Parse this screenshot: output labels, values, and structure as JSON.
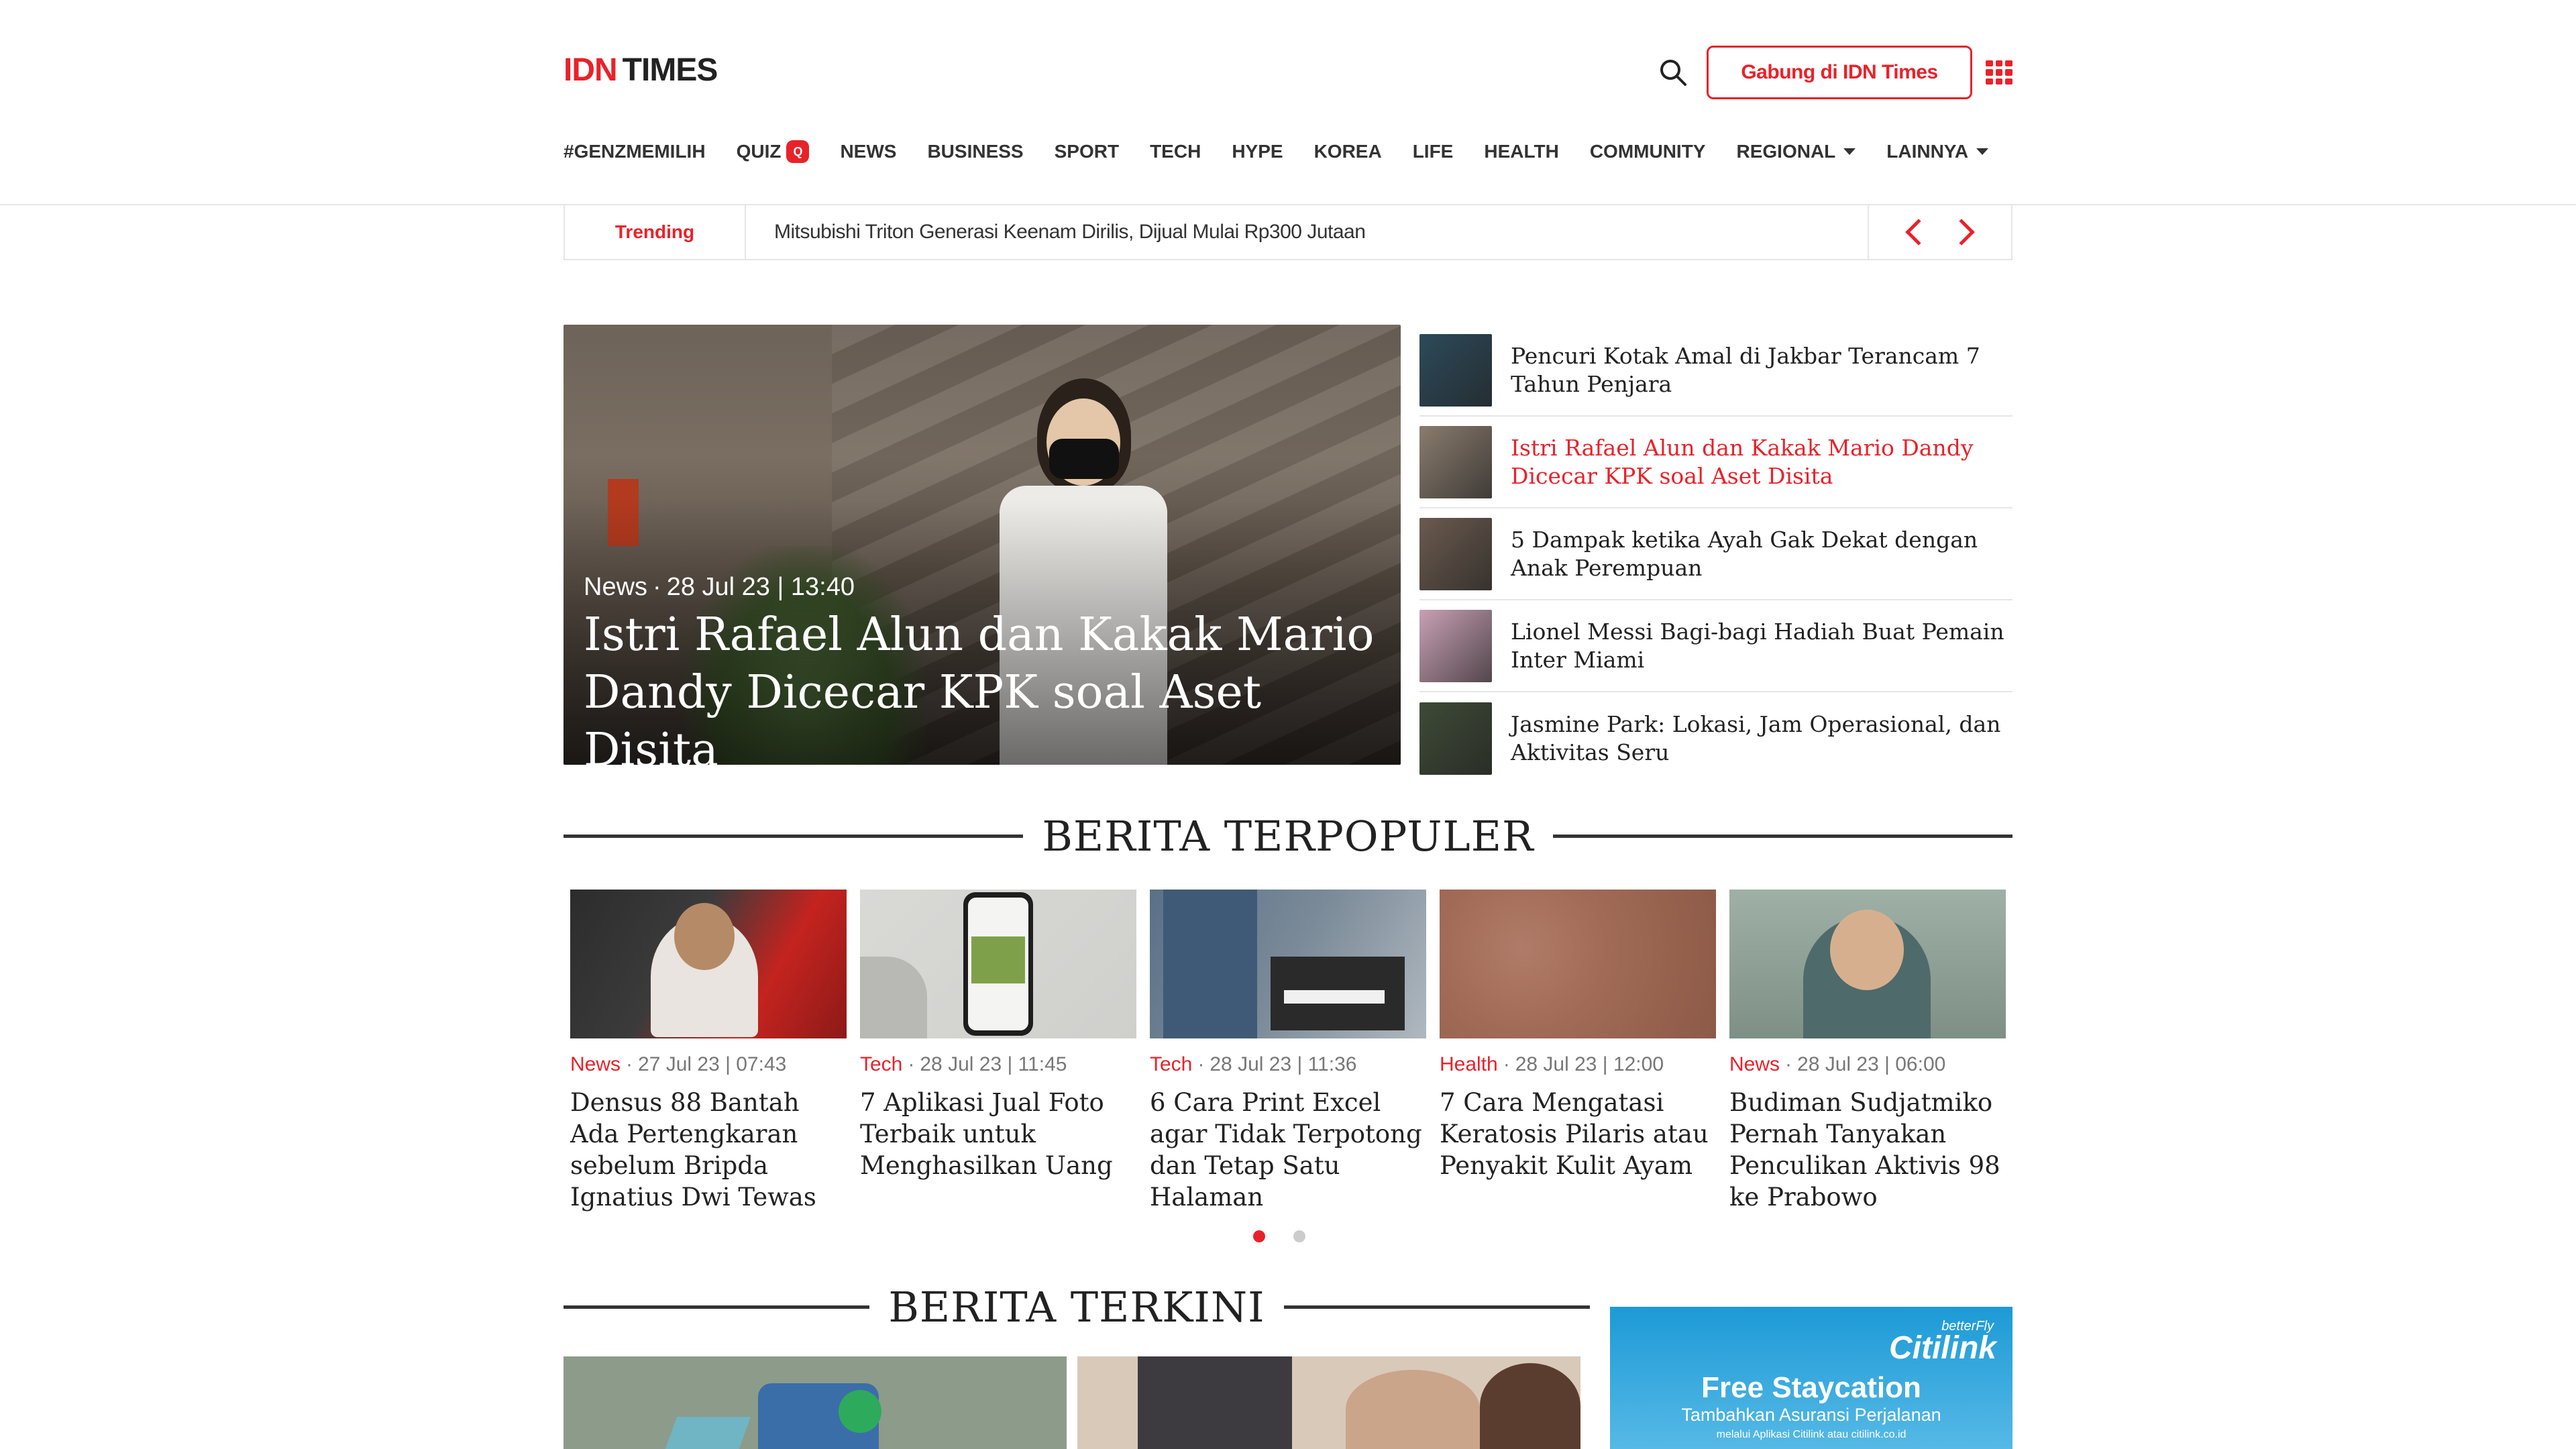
{
  "header": {
    "logo_idn": "IDN",
    "logo_times": "TIMES",
    "join_label": "Gabung di IDN Times"
  },
  "nav": {
    "items": [
      {
        "label": "#GENZMEMILIH"
      },
      {
        "label": "QUIZ",
        "badge": "Q"
      },
      {
        "label": "NEWS"
      },
      {
        "label": "BUSINESS"
      },
      {
        "label": "SPORT"
      },
      {
        "label": "TECH"
      },
      {
        "label": "HYPE"
      },
      {
        "label": "KOREA"
      },
      {
        "label": "LIFE"
      },
      {
        "label": "HEALTH"
      },
      {
        "label": "COMMUNITY"
      },
      {
        "label": "REGIONAL"
      },
      {
        "label": "LAINNYA"
      }
    ]
  },
  "trending": {
    "label": "Trending",
    "headline": "Mitsubishi Triton Generasi Keenam Dirilis, Dijual Mulai Rp300 Jutaan"
  },
  "hero": {
    "category": "News",
    "date": "28 Jul 23 | 13:40",
    "title": "Istri Rafael Alun dan Kakak Mario Dandy Dicecar KPK soal Aset Disita"
  },
  "side_list": [
    {
      "title": "Pencuri Kotak Amal di Jakbar Terancam 7 Tahun Penjara",
      "active": false,
      "color": "#2d4a5a"
    },
    {
      "title": "Istri Rafael Alun dan Kakak Mario Dandy Dicecar KPK soal Aset Disita",
      "active": true,
      "color": "#8a7c6e"
    },
    {
      "title": "5 Dampak ketika Ayah Gak Dekat dengan Anak Perempuan",
      "active": false,
      "color": "#6b5a4e"
    },
    {
      "title": "Lionel Messi Bagi-bagi Hadiah Buat Pemain Inter Miami",
      "active": false,
      "color": "#c8a0b4"
    },
    {
      "title": "Jasmine Park: Lokasi, Jam Operasional, dan Aktivitas Seru",
      "active": false,
      "color": "#3e4a36"
    }
  ],
  "sections": {
    "popular": "BERITA TERPOPULER",
    "latest": "BERITA TERKINI"
  },
  "popular": [
    {
      "category": "News",
      "date": "27 Jul 23 | 07:43",
      "title": "Densus 88 Bantah Ada Pertengkaran sebelum Bripda Ignatius Dwi Tewas"
    },
    {
      "category": "Tech",
      "date": "28 Jul 23 | 11:45",
      "title": "7 Aplikasi Jual Foto Terbaik untuk Menghasilkan Uang"
    },
    {
      "category": "Tech",
      "date": "28 Jul 23 | 11:36",
      "title": "6 Cara Print Excel agar Tidak Terpotong dan Tetap Satu Halaman"
    },
    {
      "category": "Health",
      "date": "28 Jul 23 | 12:00",
      "title": "7 Cara Mengatasi Keratosis Pilaris atau Penyakit Kulit Ayam"
    },
    {
      "category": "News",
      "date": "28 Jul 23 | 06:00",
      "title": "Budiman Sudjatmiko Pernah Tanyakan Penculikan Aktivis 98 ke Prabowo"
    }
  ],
  "carousel": {
    "pages": 2,
    "current": 1
  },
  "ad": {
    "brand_top": "betterFly",
    "brand": "Citilink",
    "headline": "Free Staycation",
    "sub": "Tambahkan Asuransi Perjalanan",
    "note": "melalui Aplikasi Citilink atau citilink.co.id"
  },
  "colors": {
    "accent": "#e8222a",
    "text": "#222222"
  }
}
